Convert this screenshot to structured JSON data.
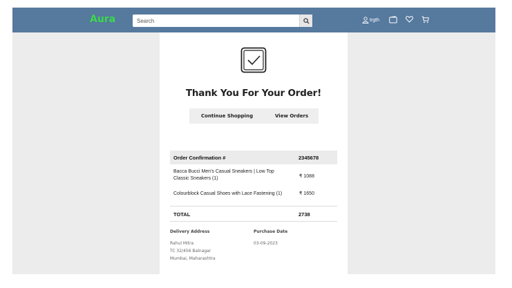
{
  "navbar": {
    "brand": "Aura",
    "search_placeholder": "Search",
    "user_name": "trgth",
    "icons": [
      "user-icon",
      "wallet-icon",
      "heart-icon",
      "cart-icon"
    ],
    "background": "#56799e",
    "brand_color": "#3ad94a"
  },
  "confirmation": {
    "heading": "Thank You For Your Order!",
    "continue_label": "Continue Shopping",
    "view_orders_label": "View Orders",
    "icon": "checkbox-check-icon"
  },
  "order": {
    "header_label": "Order Confirmation #",
    "number": "2345678",
    "items": [
      {
        "name": "Bacca Bucci Men's Casual Sneakers | Low Top Classic Sneakers (1)",
        "price": "₹ 1088"
      },
      {
        "name": "Colourblock Casual Shoes with Lace Fastening (1)",
        "price": "₹ 1650"
      }
    ],
    "total_label": "TOTAL",
    "total_value": "2738"
  },
  "delivery": {
    "heading": "Delivery Address",
    "lines": [
      "Rahul Mitra",
      "TC 32/456 Balnagar",
      "Mumbai, Maharashtra"
    ]
  },
  "purchase": {
    "heading": "Purchase Date",
    "date": "03-09-2023"
  }
}
